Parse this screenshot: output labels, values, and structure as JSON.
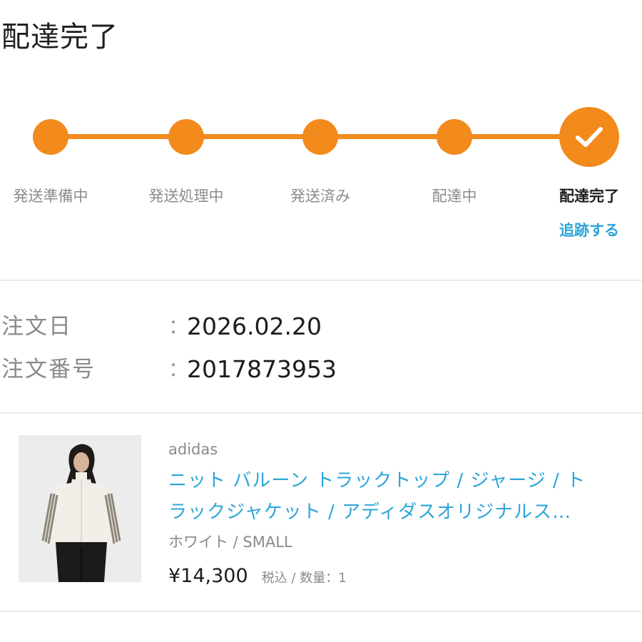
{
  "page": {
    "title": "配達完了"
  },
  "colors": {
    "accent": "#f28a1c",
    "link": "#2da5d8",
    "muted": "#8a8a8a",
    "text": "#1c1c1c"
  },
  "tracker": {
    "steps": [
      {
        "label": "発送準備中",
        "state": "done"
      },
      {
        "label": "発送処理中",
        "state": "done"
      },
      {
        "label": "発送済み",
        "state": "done"
      },
      {
        "label": "配達中",
        "state": "done"
      },
      {
        "label": "配達完了",
        "state": "current"
      }
    ],
    "current_icon": "check-icon",
    "track_link_label": "追跡する"
  },
  "order": {
    "date_label": "注文日",
    "date_value": "2026.02.20",
    "number_label": "注文番号",
    "number_value": "2017873953",
    "separator": "："
  },
  "product": {
    "image_icon": "product-photo",
    "brand": "adidas",
    "name_line1": "ニット バルーン トラックトップ / ジャージ / ト",
    "name_line2": "ラックジャケット / アディダスオリジナルス…",
    "variant": "ホワイト / SMALL",
    "price": "¥14,300",
    "price_meta": "税込 / 数量：1"
  }
}
